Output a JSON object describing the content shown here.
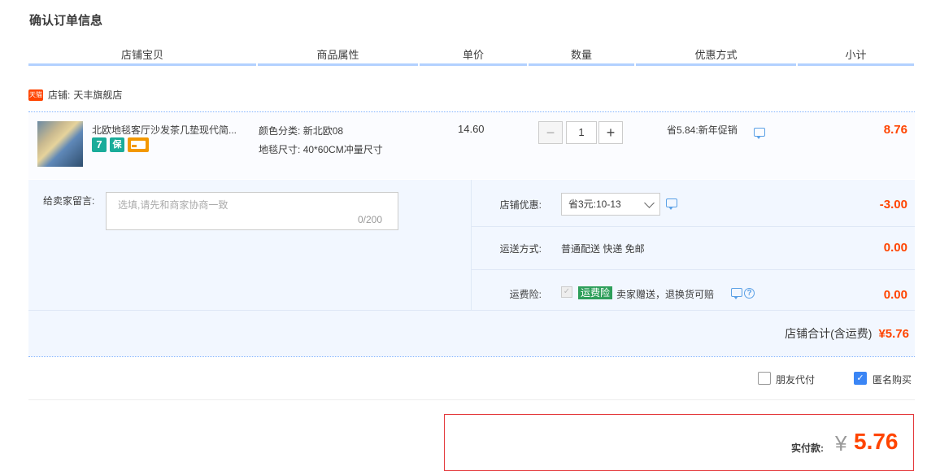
{
  "page_title": "确认订单信息",
  "columns": [
    "店铺宝贝",
    "商品属性",
    "单价",
    "数量",
    "优惠方式",
    "小计"
  ],
  "shop": {
    "badge": "天猫",
    "label": "店铺:",
    "name": "天丰旗舰店"
  },
  "item": {
    "title": "北欧地毯客厅沙发茶几垫现代简...",
    "promo_icons": [
      {
        "name": "seven-day-return-icon",
        "text": "7",
        "color": "#1aac9a"
      },
      {
        "name": "insurance-icon",
        "text": "保",
        "color": "#1aac9a"
      },
      {
        "name": "credit-card-icon",
        "text": "",
        "color": "#f39800"
      }
    ],
    "attrs": [
      {
        "label": "颜色分类:",
        "value": "新北欧08"
      },
      {
        "label": "地毯尺寸:",
        "value": "40*60CM冲量尺寸"
      }
    ],
    "unit_price": "14.60",
    "qty_minus": "−",
    "qty_plus": "+",
    "quantity": "1",
    "discount": "省5.84:新年促销",
    "subtotal": "8.76"
  },
  "message": {
    "label": "给卖家留言:",
    "placeholder": "选填,请先和商家协商一致",
    "count": "0/200"
  },
  "options": {
    "coupon_label": "店铺优惠:",
    "coupon_value": "省3元:10-13",
    "coupon_amount": "-3.00",
    "shipping_label": "运送方式:",
    "shipping_value": "普通配送 快递 免邮",
    "shipping_amount": "0.00",
    "insurance_label": "运费险:",
    "insurance_badge": "运费险",
    "insurance_text": "卖家赠送，退换货可赔",
    "insurance_help": "?",
    "insurance_amount": "0.00"
  },
  "shop_total": {
    "label": "店铺合计(含运费)",
    "amount": "¥5.76"
  },
  "checkout": {
    "friend_pay_label": "朋友代付",
    "friend_pay_checked": false,
    "anonymous_label": "匿名购买",
    "anonymous_checked": true,
    "pay_label": "实付款:",
    "currency": "¥",
    "pay_amount": "5.76"
  },
  "colors": {
    "accent_red": "#ff4400",
    "header_underline": "#b2d1ff",
    "panel_bg": "#f2f7ff",
    "checkbox_blue": "#3a85f5"
  }
}
